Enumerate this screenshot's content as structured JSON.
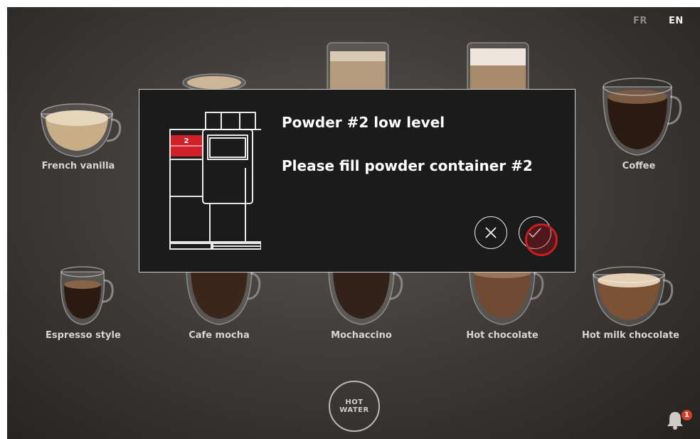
{
  "languages": {
    "fr": "FR",
    "en": "EN"
  },
  "drinks": {
    "french_vanilla": "French vanilla",
    "coffee": "Coffee",
    "espresso_style": "Espresso style",
    "cafe_mocha": "Cafe mocha",
    "mochaccino": "Mochaccino",
    "hot_chocolate": "Hot chocolate",
    "hot_milk_chocolate": "Hot milk chocolate"
  },
  "hot_water": {
    "line1": "HOT",
    "line2": "WATER"
  },
  "notifications": {
    "count": "1",
    "icon": "bell-icon"
  },
  "dialog": {
    "title": "Powder #2 low level",
    "message": "Please fill powder container #2",
    "container_number": "2",
    "highlight_color": "#d0202a",
    "cancel_icon": "close-icon",
    "confirm_icon": "check-icon"
  }
}
